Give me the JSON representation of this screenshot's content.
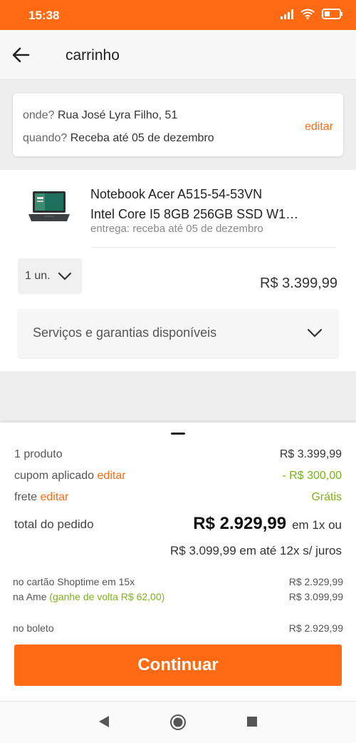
{
  "status_bar": {
    "time": "15:38",
    "icons": [
      "signal-icon",
      "wifi-icon",
      "battery-icon"
    ]
  },
  "app_bar": {
    "title": "carrinho",
    "back_icon": "arrow-left-icon"
  },
  "delivery": {
    "where_label": "onde?",
    "address": "Rua José Lyra Filho, 51",
    "when_label": "quando?",
    "when_value": "Receba até 05 de dezembro",
    "edit_label": "editar"
  },
  "product": {
    "name_line1": "Notebook Acer A515-54-53VN",
    "name_line2": "Intel Core I5 8GB 256GB SSD W1…",
    "delivery_text": "entrega: receba até 05 de dezembro",
    "quantity": "1 un.",
    "price": "R$ 3.399,99",
    "services_label": "Serviços e garantias disponíveis"
  },
  "summary": {
    "products_label": "1 produto",
    "products_value": "R$ 3.399,99",
    "coupon_label": "cupom aplicado",
    "coupon_edit": "editar",
    "coupon_value": "- R$ 300,00",
    "shipping_label": "frete",
    "shipping_edit": "editar",
    "shipping_value": "Grátis",
    "total_label": "total do pedido",
    "total_value": "R$ 2.929,99",
    "total_suffix": "em 1x ou",
    "installments": "R$ 3.099,99 em até 12x s/ juros",
    "card_label": "no cartão Shoptime em 15x",
    "card_value": "R$ 2.929,99",
    "ame_label": "na Ame",
    "ame_cashback": "(ganhe de volta R$ 62,00)",
    "ame_value": "R$ 3.099,99",
    "boleto_label": "no boleto",
    "boleto_value": "R$ 2.929,99",
    "continue_label": "Continuar"
  },
  "colors": {
    "accent": "#ff6a13",
    "green": "#7ab317"
  }
}
